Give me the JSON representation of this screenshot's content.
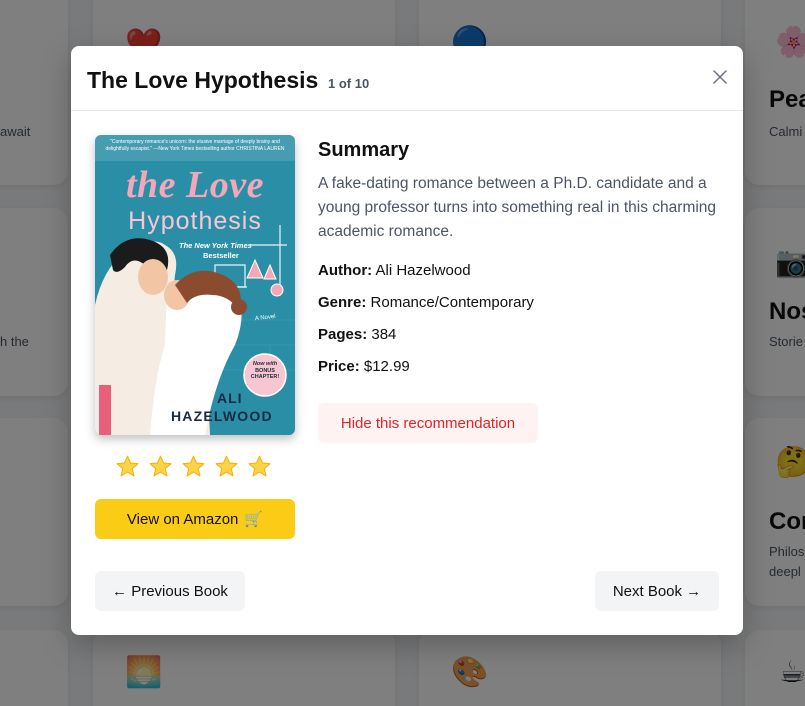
{
  "background": {
    "cards": [
      {
        "emoji": "❤️",
        "icon": "heart-icon",
        "title": "",
        "desc": "await"
      },
      {
        "emoji": "🔵",
        "icon": "globe-icon",
        "title": "",
        "desc": ""
      },
      {
        "emoji": "🌸",
        "icon": "flower-icon",
        "title": "Pea",
        "desc": "Calmi"
      },
      {
        "emoji": "",
        "icon": "",
        "title": "",
        "desc": "h the"
      },
      {
        "emoji": "📷",
        "icon": "camera-icon",
        "title": "Nos",
        "desc": "Storie"
      },
      {
        "emoji": "🤔",
        "icon": "thinking-face-icon",
        "title": "Con",
        "desc": "Philos"
      },
      {
        "emoji": "",
        "icon": "",
        "title": "",
        "desc": "deepl"
      },
      {
        "emoji": "🌅",
        "icon": "sunrise-icon",
        "title": "",
        "desc": ""
      },
      {
        "emoji": "🎨",
        "icon": "palette-icon",
        "title": "",
        "desc": ""
      },
      {
        "emoji": "☕",
        "icon": "coffee-icon",
        "title": "",
        "desc": ""
      }
    ]
  },
  "modal": {
    "title": "The Love Hypothesis",
    "counter": "1 of 10",
    "close_icon": "close-icon",
    "cover": {
      "quote": "\"Contemporary romance's unicorn: the elusive marriage of deeply brainy and delightfully escapist.\" —New York Times bestselling author CHRISTINA LAUREN",
      "title_line1": "the Love",
      "title_line2": "Hypothesis",
      "badge_line1": "The New York Times",
      "badge_line2": "Bestseller",
      "side_label": "A Novel",
      "sticker_line1": "Now with",
      "sticker_line2": "BONUS",
      "sticker_line3": "CHAPTER!",
      "author_line1": "ALI",
      "author_line2": "HAZELWOOD"
    },
    "rating": 5,
    "amazon_label": "View on Amazon",
    "amazon_icon": "cart-icon",
    "summary_heading": "Summary",
    "summary_text": "A fake-dating romance between a Ph.D. candidate and a young professor turns into something real in this charming academic romance.",
    "author_label": "Author:",
    "author_value": "Ali Hazelwood",
    "genre_label": "Genre:",
    "genre_value": "Romance/Contemporary",
    "pages_label": "Pages:",
    "pages_value": "384",
    "price_label": "Price:",
    "price_value": "$12.99",
    "hide_label": "Hide this recommendation",
    "prev_label": "← Previous Book",
    "next_label": "Next Book →"
  },
  "colors": {
    "accent_yellow": "#facc15",
    "cover_teal": "#2a8fa6",
    "danger_red": "#dc2626",
    "star": "#fcd34d"
  }
}
